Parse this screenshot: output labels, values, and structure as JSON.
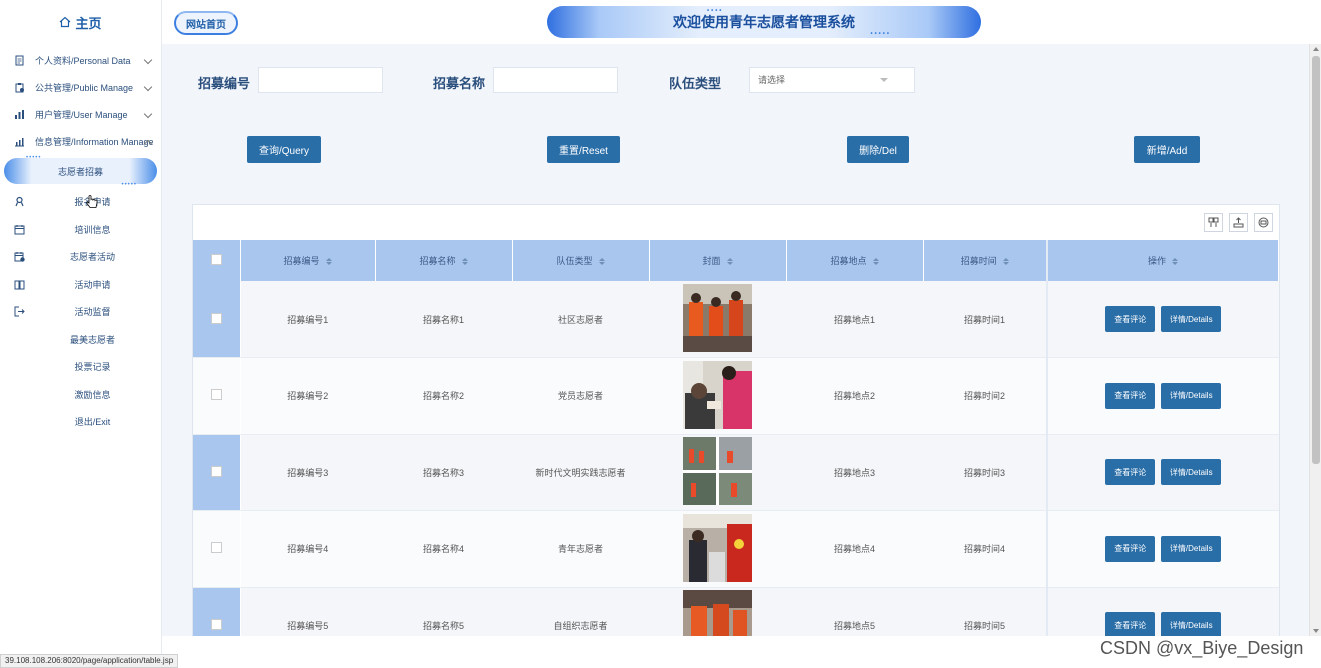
{
  "sidebar": {
    "home_label": "主页",
    "groups": [
      {
        "label": "个人资料/Personal Data"
      },
      {
        "label": "公共管理/Public Manage"
      },
      {
        "label": "用户管理/User Manage"
      },
      {
        "label": "信息管理/Information Manage"
      }
    ],
    "active_sub": "志愿者招募",
    "sub_items": [
      {
        "label": "报名申请",
        "icon": "user-badge-icon"
      },
      {
        "label": "培训信息",
        "icon": "calendar-icon"
      },
      {
        "label": "志愿者活动",
        "icon": "calendar-check-icon"
      },
      {
        "label": "活动申请",
        "icon": "book-icon"
      },
      {
        "label": "活动监督",
        "icon": "logout-icon"
      },
      {
        "label": "最美志愿者",
        "icon": ""
      },
      {
        "label": "投票记录",
        "icon": ""
      },
      {
        "label": "激励信息",
        "icon": ""
      },
      {
        "label": "退出/Exit",
        "icon": ""
      }
    ]
  },
  "topbar": {
    "site_home": "网站首页",
    "title": "欢迎使用青年志愿者管理系统"
  },
  "filters": {
    "id_label": "招募编号",
    "name_label": "招募名称",
    "team_label": "队伍类型",
    "team_placeholder": "请选择"
  },
  "buttons": {
    "query": "查询/Query",
    "reset": "重置/Reset",
    "delete": "删除/Del",
    "add": "新增/Add"
  },
  "table": {
    "headers": [
      "招募编号",
      "招募名称",
      "队伍类型",
      "封面",
      "招募地点",
      "招募时间",
      "操作"
    ],
    "rows": [
      {
        "id": "招募编号1",
        "name": "招募名称1",
        "team": "社区志愿者",
        "place": "招募地点1",
        "time": "招募时间1"
      },
      {
        "id": "招募编号2",
        "name": "招募名称2",
        "team": "党员志愿者",
        "place": "招募地点2",
        "time": "招募时间2"
      },
      {
        "id": "招募编号3",
        "name": "招募名称3",
        "team": "新时代文明实践志愿者",
        "place": "招募地点3",
        "time": "招募时间3"
      },
      {
        "id": "招募编号4",
        "name": "招募名称4",
        "team": "青年志愿者",
        "place": "招募地点4",
        "time": "招募时间4"
      },
      {
        "id": "招募编号5",
        "name": "招募名称5",
        "team": "自组织志愿者",
        "place": "招募地点5",
        "time": "招募时间5"
      }
    ],
    "view_comments": "查看评论",
    "details": "详情/Details"
  },
  "status_url": "39.108.108.206:8020/page/application/table.jsp",
  "watermark": "CSDN @vx_Biye_Design",
  "colors": {
    "primary_button": "#2a6ea8",
    "header_bg": "#a9c6ef",
    "accent": "#3d7fe0"
  }
}
